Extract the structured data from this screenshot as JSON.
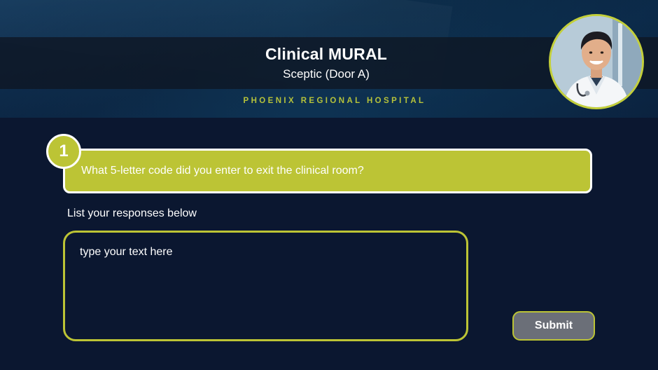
{
  "header": {
    "title": "Clinical MURAL",
    "subtitle": "Sceptic (Door A)",
    "hospital": "PHOENIX REGIONAL HOSPITAL",
    "avatar_icon": "doctor-portrait"
  },
  "question": {
    "number": "1",
    "text": "What 5-letter code did you enter to exit the clinical room?"
  },
  "response": {
    "label": "List your responses below",
    "value": "",
    "placeholder": "type your text here"
  },
  "submit": {
    "label": "Submit"
  },
  "colors": {
    "background": "#0b1730",
    "accent": "#bcc435",
    "button": "#6b6f78",
    "text": "#ffffff"
  }
}
